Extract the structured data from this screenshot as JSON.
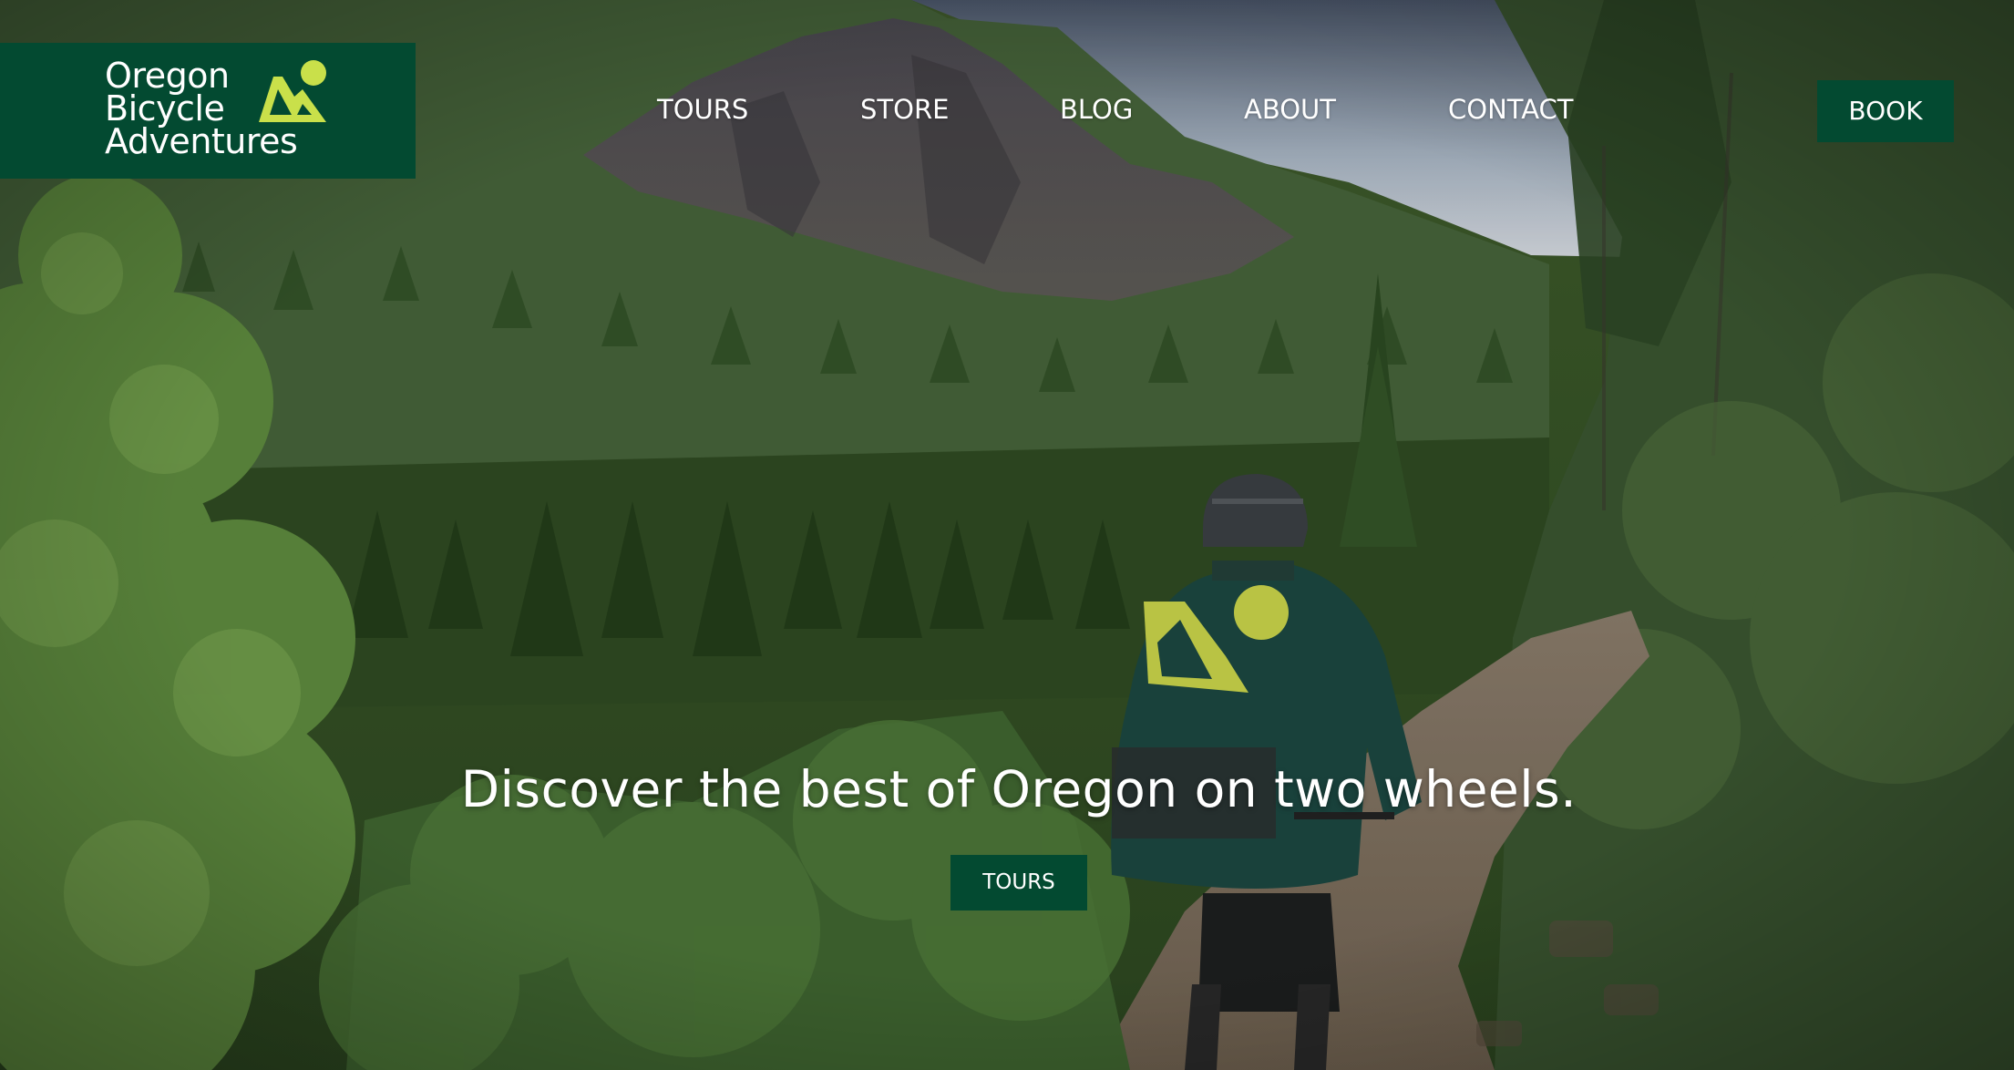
{
  "brand": {
    "name_lines": [
      "Oregon",
      "Bicycle",
      "Adventures"
    ],
    "mark": "mountain-sun-logo",
    "color": "#034a31",
    "accent": "#c9e04a"
  },
  "nav": {
    "items": [
      {
        "label": "TOURS"
      },
      {
        "label": "STORE"
      },
      {
        "label": "BLOG"
      },
      {
        "label": "ABOUT"
      },
      {
        "label": "CONTACT"
      }
    ],
    "book_label": "BOOK"
  },
  "hero": {
    "headline": "Discover the best of Oregon on two wheels.",
    "cta_label": "TOURS"
  }
}
